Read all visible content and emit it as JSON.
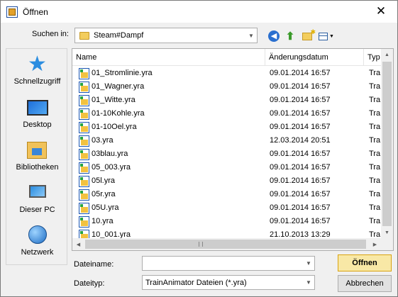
{
  "window": {
    "title": "Öffnen",
    "close_symbol": "✕"
  },
  "lookin": {
    "label": "Suchen in:",
    "value": "Steam#Dampf"
  },
  "places": [
    {
      "label": "Schnellzugriff",
      "icon": "star-icon"
    },
    {
      "label": "Desktop",
      "icon": "desktop-icon"
    },
    {
      "label": "Bibliotheken",
      "icon": "library-icon"
    },
    {
      "label": "Dieser PC",
      "icon": "computer-icon"
    },
    {
      "label": "Netzwerk",
      "icon": "network-icon"
    }
  ],
  "columns": {
    "name": "Name",
    "date": "Änderungsdatum",
    "type": "Typ"
  },
  "files": [
    {
      "name": "01_Stromlinie.yra",
      "date": "09.01.2014 16:57",
      "type": "Tra"
    },
    {
      "name": "01_Wagner.yra",
      "date": "09.01.2014 16:57",
      "type": "Tra"
    },
    {
      "name": "01_Witte.yra",
      "date": "09.01.2014 16:57",
      "type": "Tra"
    },
    {
      "name": "01-10Kohle.yra",
      "date": "09.01.2014 16:57",
      "type": "Tra"
    },
    {
      "name": "01-10Oel.yra",
      "date": "09.01.2014 16:57",
      "type": "Tra"
    },
    {
      "name": "03.yra",
      "date": "12.03.2014 20:51",
      "type": "Tra"
    },
    {
      "name": "03blau.yra",
      "date": "09.01.2014 16:57",
      "type": "Tra"
    },
    {
      "name": "05_003.yra",
      "date": "09.01.2014 16:57",
      "type": "Tra"
    },
    {
      "name": "05l.yra",
      "date": "09.01.2014 16:57",
      "type": "Tra"
    },
    {
      "name": "05r.yra",
      "date": "09.01.2014 16:57",
      "type": "Tra"
    },
    {
      "name": "05U.yra",
      "date": "09.01.2014 16:57",
      "type": "Tra"
    },
    {
      "name": "10.yra",
      "date": "09.01.2014 16:57",
      "type": "Tra"
    },
    {
      "name": "10_001.yra",
      "date": "21.10.2013 13:29",
      "type": "Tra"
    }
  ],
  "filename": {
    "label": "Dateiname:",
    "value": ""
  },
  "filetype": {
    "label": "Dateityp:",
    "value": "TrainAnimator Dateien (*.yra)"
  },
  "buttons": {
    "open": "Öffnen",
    "cancel": "Abbrechen"
  }
}
